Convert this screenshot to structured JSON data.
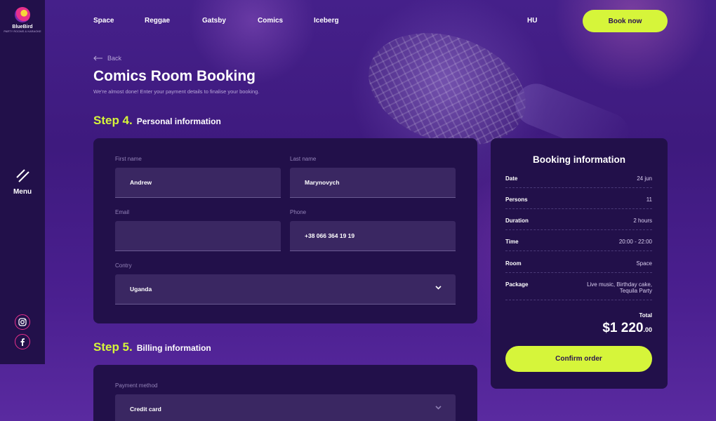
{
  "brand": {
    "name": "BlueBird",
    "tagline": "PARTY ROOMS & KARAOKE"
  },
  "sidebar": {
    "menu_label": "Menu",
    "social": [
      "instagram-icon",
      "facebook-icon"
    ]
  },
  "nav": {
    "items": [
      "Space",
      "Reggae",
      "Gatsby",
      "Comics",
      "Iceberg"
    ],
    "language": "HU",
    "book_now": "Book now"
  },
  "page": {
    "back": "Back",
    "title": "Comics Room Booking",
    "subtitle": "We're almost done! Enter your payment details to finalise your booking."
  },
  "step4": {
    "number": "Step 4.",
    "label": "Personal information"
  },
  "form": {
    "first_name_label": "First name",
    "first_name": "Andrew",
    "last_name_label": "Last name",
    "last_name": "Marynovych",
    "email_label": "Email",
    "email": "",
    "phone_label": "Phone",
    "phone": "+38 066 364 19 19",
    "country_label": "Contry",
    "country": "Uganda"
  },
  "step5": {
    "number": "Step 5.",
    "label": "Billing information"
  },
  "billing": {
    "payment_method_label": "Payment method",
    "payment_method": "Credit card"
  },
  "booking": {
    "title": "Booking information",
    "rows": [
      {
        "key": "Date",
        "value": "24 jun"
      },
      {
        "key": "Persons",
        "value": "11"
      },
      {
        "key": "Duration",
        "value": "2 hours"
      },
      {
        "key": "Time",
        "value": "20:00 - 22:00"
      },
      {
        "key": "Room",
        "value": "Space"
      },
      {
        "key": "Package",
        "value": "Live music, Birthday cake, Tequila Party"
      }
    ],
    "total_label": "Total",
    "total_main": "$1 220",
    "total_cents": ".00",
    "confirm": "Confirm order"
  },
  "colors": {
    "accent": "#d6f53a",
    "card": "#22104a",
    "field": "#3a2762",
    "social_ring": "#e8308c"
  }
}
